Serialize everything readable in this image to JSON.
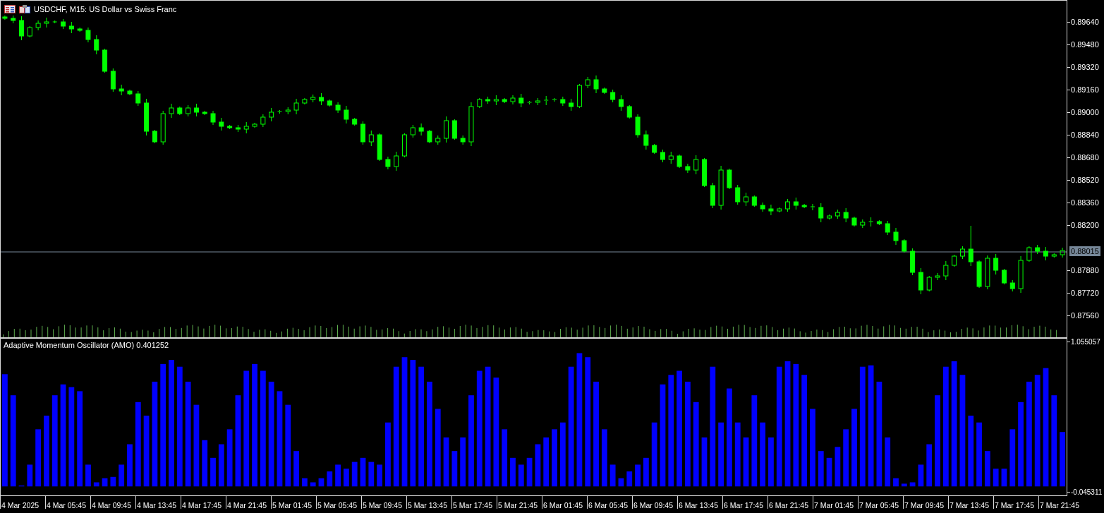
{
  "chart_window": {
    "symbol_title": "USDCHF, M15:  US Dollar vs Swiss Franc"
  },
  "price_pane": {
    "chart_data": {
      "type": "candlestick",
      "ylim": [
        0.8741,
        0.89795
      ],
      "ref_lines": [
        {
          "axis": "y",
          "value": 0.88015,
          "label": "0.88015",
          "color": "#778899"
        }
      ],
      "yticks": [
        {
          "value": 0.8964,
          "label": "0.89640"
        },
        {
          "value": 0.8948,
          "label": "0.89480"
        },
        {
          "value": 0.8932,
          "label": "0.89320"
        },
        {
          "value": 0.8916,
          "label": "0.89160"
        },
        {
          "value": 0.89,
          "label": "0.89000"
        },
        {
          "value": 0.8884,
          "label": "0.88840"
        },
        {
          "value": 0.8868,
          "label": "0.88680"
        },
        {
          "value": 0.8852,
          "label": "0.88520"
        },
        {
          "value": 0.8836,
          "label": "0.88360"
        },
        {
          "value": 0.882,
          "label": "0.88200"
        },
        {
          "value": 0.8788,
          "label": "0.87880"
        },
        {
          "value": 0.8772,
          "label": "0.87720"
        },
        {
          "value": 0.8756,
          "label": "0.87560"
        }
      ],
      "ohlc": [
        [
          0.8968,
          0.8969,
          0.8966,
          0.8967
        ],
        [
          0.8967,
          0.8969,
          0.89635,
          0.89655
        ],
        [
          0.89655,
          0.89685,
          0.89515,
          0.89545
        ],
        [
          0.89545,
          0.89615,
          0.89535,
          0.89605
        ],
        [
          0.89605,
          0.89655,
          0.89585,
          0.89635
        ],
        [
          0.89635,
          0.89675,
          0.89605,
          0.89645
        ],
        [
          0.89645,
          0.89655,
          0.89635,
          0.89645
        ],
        [
          0.89645,
          0.89665,
          0.89595,
          0.89615
        ],
        [
          0.89615,
          0.89645,
          0.89565,
          0.89595
        ],
        [
          0.89595,
          0.89605,
          0.89575,
          0.89585
        ],
        [
          0.89585,
          0.89605,
          0.895,
          0.8952
        ],
        [
          0.8952,
          0.8955,
          0.89415,
          0.89445
        ],
        [
          0.89445,
          0.89455,
          0.89285,
          0.89295
        ],
        [
          0.89295,
          0.89315,
          0.8915,
          0.8917
        ],
        [
          0.8917,
          0.892,
          0.89125,
          0.89155
        ],
        [
          0.89155,
          0.89165,
          0.89125,
          0.89135
        ],
        [
          0.89135,
          0.89155,
          0.8905,
          0.8907
        ],
        [
          0.8907,
          0.891,
          0.8884,
          0.8887
        ],
        [
          0.8887,
          0.8888,
          0.88785,
          0.88795
        ],
        [
          0.88795,
          0.89015,
          0.88775,
          0.88995
        ],
        [
          0.88995,
          0.89065,
          0.88965,
          0.89035
        ],
        [
          0.89035,
          0.89045,
          0.88985,
          0.88995
        ],
        [
          0.88995,
          0.89055,
          0.88975,
          0.89035
        ],
        [
          0.89035,
          0.89065,
          0.88975,
          0.89005
        ],
        [
          0.89005,
          0.89015,
          0.88985,
          0.88995
        ],
        [
          0.88995,
          0.89015,
          0.88915,
          0.88935
        ],
        [
          0.88935,
          0.88965,
          0.88875,
          0.88905
        ],
        [
          0.88905,
          0.88915,
          0.88885,
          0.88895
        ],
        [
          0.88895,
          0.88915,
          0.88865,
          0.88885
        ],
        [
          0.88885,
          0.88935,
          0.88855,
          0.88905
        ],
        [
          0.88905,
          0.8893,
          0.88895,
          0.8892
        ],
        [
          0.8892,
          0.8899,
          0.889,
          0.8897
        ],
        [
          0.8897,
          0.89035,
          0.8894,
          0.89005
        ],
        [
          0.89005,
          0.8902,
          0.88995,
          0.8901
        ],
        [
          0.8901,
          0.8904,
          0.8899,
          0.8902
        ],
        [
          0.8902,
          0.891,
          0.8899,
          0.8907
        ],
        [
          0.8907,
          0.89105,
          0.8906,
          0.89095
        ],
        [
          0.89095,
          0.8913,
          0.89075,
          0.8911
        ],
        [
          0.8911,
          0.8914,
          0.89055,
          0.89085
        ],
        [
          0.89085,
          0.89095,
          0.89045,
          0.89055
        ],
        [
          0.89055,
          0.89075,
          0.89,
          0.8902
        ],
        [
          0.8902,
          0.8905,
          0.88925,
          0.88955
        ],
        [
          0.88955,
          0.88965,
          0.8891,
          0.8892
        ],
        [
          0.8892,
          0.8894,
          0.88775,
          0.88795
        ],
        [
          0.88795,
          0.88875,
          0.88765,
          0.88845
        ],
        [
          0.88845,
          0.88855,
          0.8866,
          0.8867
        ],
        [
          0.8867,
          0.8869,
          0.886,
          0.8862
        ],
        [
          0.8862,
          0.88725,
          0.8859,
          0.88695
        ],
        [
          0.88695,
          0.88855,
          0.88685,
          0.88845
        ],
        [
          0.88845,
          0.88915,
          0.88825,
          0.88895
        ],
        [
          0.88895,
          0.88925,
          0.8884,
          0.8887
        ],
        [
          0.8887,
          0.8888,
          0.88785,
          0.88795
        ],
        [
          0.88795,
          0.8884,
          0.88775,
          0.8882
        ],
        [
          0.8882,
          0.88975,
          0.8879,
          0.88945
        ],
        [
          0.88945,
          0.88955,
          0.8881,
          0.8882
        ],
        [
          0.8882,
          0.8884,
          0.88775,
          0.88795
        ],
        [
          0.88795,
          0.89075,
          0.88765,
          0.89045
        ],
        [
          0.89045,
          0.89105,
          0.89035,
          0.89095
        ],
        [
          0.89095,
          0.89115,
          0.89065,
          0.89085
        ],
        [
          0.89085,
          0.89125,
          0.89055,
          0.89095
        ],
        [
          0.89095,
          0.89105,
          0.8907,
          0.8908
        ],
        [
          0.8908,
          0.89125,
          0.8906,
          0.89105
        ],
        [
          0.89105,
          0.89135,
          0.8904,
          0.8907
        ],
        [
          0.8907,
          0.89085,
          0.8906,
          0.89075
        ],
        [
          0.89075,
          0.89105,
          0.89055,
          0.89085
        ],
        [
          0.89085,
          0.8912,
          0.89055,
          0.8909
        ],
        [
          0.8909,
          0.89105,
          0.8908,
          0.89095
        ],
        [
          0.89095,
          0.89115,
          0.8905,
          0.8907
        ],
        [
          0.8907,
          0.891,
          0.89015,
          0.89045
        ],
        [
          0.89045,
          0.89205,
          0.89035,
          0.89195
        ],
        [
          0.89195,
          0.89255,
          0.89175,
          0.89235
        ],
        [
          0.89235,
          0.89265,
          0.8914,
          0.8917
        ],
        [
          0.8917,
          0.8918,
          0.89135,
          0.89145
        ],
        [
          0.89145,
          0.89165,
          0.89075,
          0.89095
        ],
        [
          0.89095,
          0.89125,
          0.89015,
          0.89045
        ],
        [
          0.89045,
          0.89055,
          0.8896,
          0.8897
        ],
        [
          0.8897,
          0.8899,
          0.88825,
          0.88845
        ],
        [
          0.88845,
          0.88875,
          0.8874,
          0.8877
        ],
        [
          0.8877,
          0.8878,
          0.8871,
          0.8872
        ],
        [
          0.8872,
          0.8874,
          0.8865,
          0.8867
        ],
        [
          0.8867,
          0.88725,
          0.8864,
          0.88695
        ],
        [
          0.88695,
          0.88705,
          0.8861,
          0.8862
        ],
        [
          0.8862,
          0.8864,
          0.88575,
          0.88595
        ],
        [
          0.88595,
          0.887,
          0.88565,
          0.8867
        ],
        [
          0.8867,
          0.8868,
          0.88475,
          0.88485
        ],
        [
          0.88485,
          0.88505,
          0.88325,
          0.88345
        ],
        [
          0.88345,
          0.88625,
          0.88315,
          0.88595
        ],
        [
          0.88595,
          0.88605,
          0.8846,
          0.8847
        ],
        [
          0.8847,
          0.8849,
          0.8835,
          0.8837
        ],
        [
          0.8837,
          0.88435,
          0.8834,
          0.88405
        ],
        [
          0.88405,
          0.88415,
          0.88335,
          0.88345
        ],
        [
          0.88345,
          0.88365,
          0.883,
          0.8832
        ],
        [
          0.8832,
          0.8835,
          0.88275,
          0.88305
        ],
        [
          0.88305,
          0.8833,
          0.88295,
          0.8832
        ],
        [
          0.8832,
          0.8839,
          0.883,
          0.8837
        ],
        [
          0.8837,
          0.884,
          0.88315,
          0.88345
        ],
        [
          0.88345,
          0.88355,
          0.88325,
          0.88335
        ],
        [
          0.88335,
          0.88355,
          0.8831,
          0.8833
        ],
        [
          0.8833,
          0.8836,
          0.88225,
          0.88255
        ],
        [
          0.88255,
          0.8828,
          0.88245,
          0.8827
        ],
        [
          0.8827,
          0.88315,
          0.8825,
          0.88295
        ],
        [
          0.88295,
          0.88325,
          0.88225,
          0.88255
        ],
        [
          0.88255,
          0.88265,
          0.88195,
          0.88205
        ],
        [
          0.88205,
          0.88245,
          0.88185,
          0.88225
        ],
        [
          0.88225,
          0.8826,
          0.88195,
          0.8823
        ],
        [
          0.8823,
          0.8824,
          0.88205,
          0.88215
        ],
        [
          0.88215,
          0.88235,
          0.88135,
          0.88155
        ],
        [
          0.88155,
          0.88185,
          0.88065,
          0.88095
        ],
        [
          0.88095,
          0.88105,
          0.8801,
          0.8802
        ],
        [
          0.8802,
          0.8804,
          0.8785,
          0.8787
        ],
        [
          0.8787,
          0.879,
          0.87715,
          0.87745
        ],
        [
          0.87745,
          0.87845,
          0.87735,
          0.87835
        ],
        [
          0.87835,
          0.87865,
          0.87815,
          0.87845
        ],
        [
          0.87845,
          0.8795,
          0.87815,
          0.8792
        ],
        [
          0.8792,
          0.87995,
          0.8791,
          0.87985
        ],
        [
          0.87985,
          0.88055,
          0.87965,
          0.88035
        ],
        [
          0.88035,
          0.882,
          0.87915,
          0.87945
        ],
        [
          0.87945,
          0.87955,
          0.8776,
          0.8777
        ],
        [
          0.8777,
          0.8799,
          0.8775,
          0.8797
        ],
        [
          0.8797,
          0.88,
          0.87855,
          0.87885
        ],
        [
          0.87885,
          0.87895,
          0.87785,
          0.87795
        ],
        [
          0.87795,
          0.87815,
          0.87735,
          0.87755
        ],
        [
          0.87755,
          0.87985,
          0.87725,
          0.87955
        ],
        [
          0.87955,
          0.88055,
          0.87945,
          0.88045
        ],
        [
          0.88045,
          0.88065,
          0.88,
          0.8802
        ],
        [
          0.8802,
          0.8805,
          0.87955,
          0.87985
        ],
        [
          0.87985,
          0.88005,
          0.87975,
          0.87995
        ],
        [
          0.87995,
          0.88045,
          0.87975,
          0.88025
        ]
      ]
    }
  },
  "oscillator_pane": {
    "label": "Adaptive Momentum Oscillator (AMO) 0.401252",
    "chart_data": {
      "type": "bar",
      "ylim": [
        -0.0659,
        1.086
      ],
      "yticks": [
        {
          "value": 1.055057,
          "label": "1.055057"
        },
        {
          "value": -0.045311,
          "label": "-0.045311"
        }
      ],
      "series": [
        {
          "color": "#0000ff",
          "values": [
            0.825,
            0.67,
            0.006,
            0.16,
            0.42,
            0.52,
            0.67,
            0.75,
            0.73,
            0.7,
            0.16,
            0.03,
            0.06,
            0.07,
            0.16,
            0.31,
            0.62,
            0.52,
            0.77,
            0.9,
            0.93,
            0.88,
            0.77,
            0.6,
            0.34,
            0.21,
            0.31,
            0.42,
            0.67,
            0.85,
            0.9,
            0.85,
            0.77,
            0.7,
            0.6,
            0.26,
            0.06,
            0.03,
            0.06,
            0.11,
            0.16,
            0.13,
            0.18,
            0.21,
            0.18,
            0.16,
            0.47,
            0.88,
            0.95,
            0.93,
            0.88,
            0.77,
            0.57,
            0.36,
            0.26,
            0.36,
            0.67,
            0.85,
            0.88,
            0.8,
            0.42,
            0.21,
            0.16,
            0.21,
            0.31,
            0.36,
            0.42,
            0.47,
            0.88,
            0.98,
            0.95,
            0.77,
            0.42,
            0.16,
            0.06,
            0.11,
            0.16,
            0.21,
            0.47,
            0.75,
            0.82,
            0.85,
            0.77,
            0.62,
            0.36,
            0.88,
            0.47,
            0.72,
            0.47,
            0.36,
            0.67,
            0.47,
            0.36,
            0.88,
            0.92,
            0.9,
            0.82,
            0.57,
            0.26,
            0.21,
            0.29,
            0.42,
            0.57,
            0.88,
            0.89,
            0.77,
            0.36,
            0.06,
            0.02,
            0.03,
            0.16,
            0.31,
            0.67,
            0.88,
            0.92,
            0.82,
            0.52,
            0.47,
            0.26,
            0.13,
            0.13,
            0.42,
            0.62,
            0.77,
            0.82,
            0.87,
            0.67,
            0.4
          ]
        }
      ]
    }
  },
  "time_axis": [
    "4 Mar 2025",
    "4 Mar 05:45",
    "4 Mar 09:45",
    "4 Mar 13:45",
    "4 Mar 17:45",
    "4 Mar 21:45",
    "5 Mar 01:45",
    "5 Mar 05:45",
    "5 Mar 09:45",
    "5 Mar 13:45",
    "5 Mar 17:45",
    "5 Mar 21:45",
    "6 Mar 01:45",
    "6 Mar 05:45",
    "6 Mar 09:45",
    "6 Mar 13:45",
    "6 Mar 17:45",
    "6 Mar 21:45",
    "7 Mar 01:45",
    "7 Mar 05:45",
    "7 Mar 09:45",
    "7 Mar 13:45",
    "7 Mar 17:45",
    "7 Mar 21:45"
  ]
}
